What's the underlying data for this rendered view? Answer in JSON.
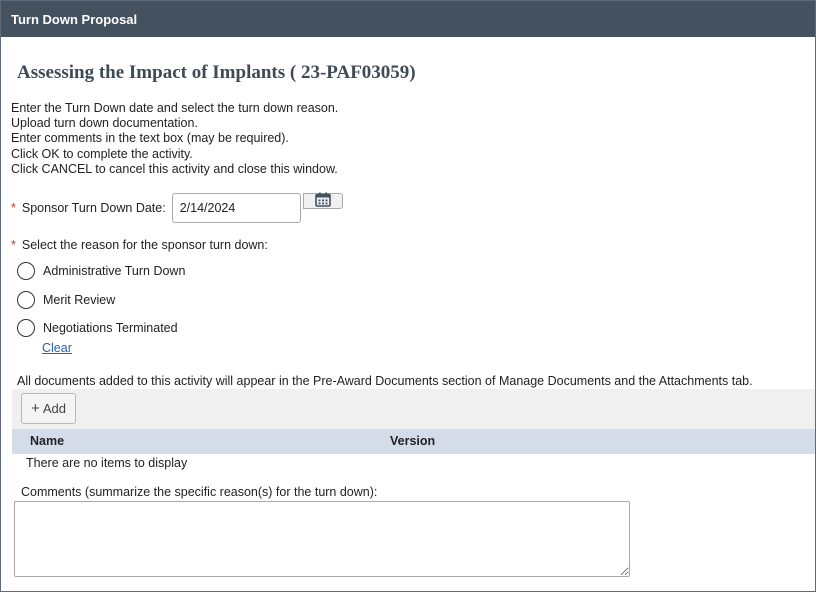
{
  "window": {
    "title": "Turn Down Proposal"
  },
  "heading": "Assessing the Impact of Implants ( 23-PAF03059)",
  "instructions": [
    "Enter the Turn Down date and select the turn down reason.",
    "Upload turn down documentation.",
    "Enter comments in the text box (may be required).",
    "Click OK to complete the activity.",
    "Click CANCEL to cancel this activity and close this window."
  ],
  "required_marker": "*",
  "turn_down_date": {
    "label": "Sponsor Turn Down Date:",
    "value": "2/14/2024",
    "icon": "calendar-icon"
  },
  "reason": {
    "label": "Select the reason for the sponsor turn down:",
    "options": [
      "Administrative Turn Down",
      "Merit Review",
      "Negotiations Terminated"
    ],
    "selected": null,
    "clear_label": "Clear"
  },
  "documents": {
    "note": "All documents added to this activity will appear in the Pre-Award Documents section of Manage Documents and the Attachments tab.",
    "add_label": "Add",
    "columns": [
      "Name",
      "Version"
    ],
    "empty_message": "There are no items to display"
  },
  "comments": {
    "label": "Comments (summarize the specific reason(s) for the turn down):",
    "value": ""
  },
  "colors": {
    "titlebar": "#44515f",
    "table_header": "#d4dce9",
    "link": "#2a62a8",
    "required": "#c0392b"
  }
}
